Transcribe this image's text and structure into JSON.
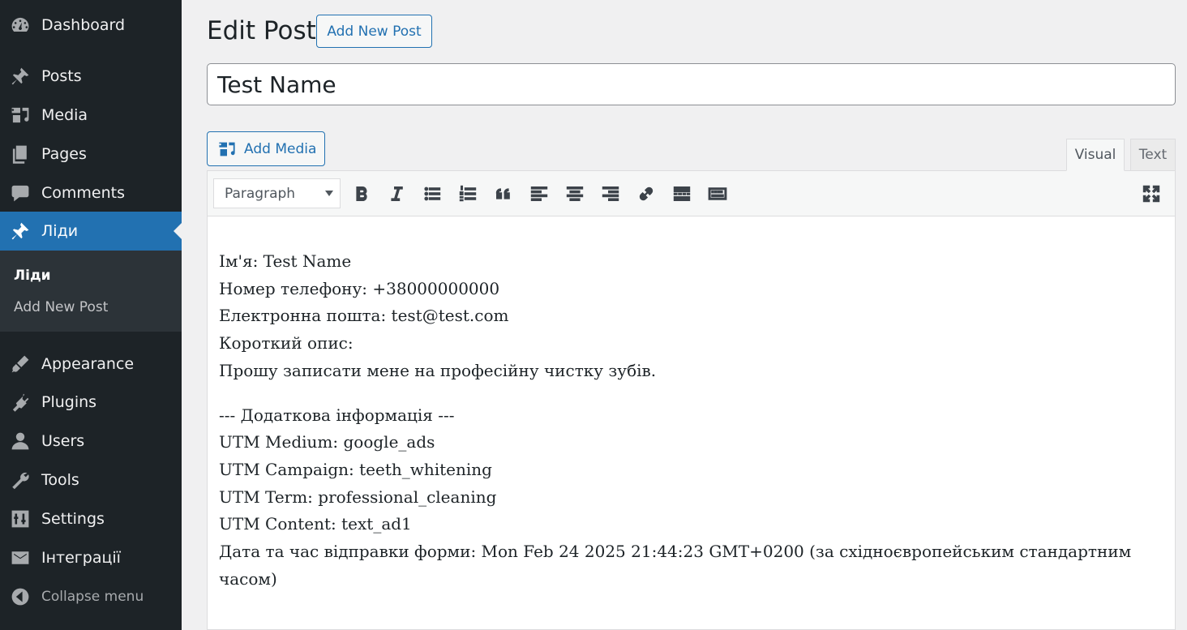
{
  "sidebar": {
    "items": [
      {
        "label": "Dashboard",
        "icon": "dashboard-icon"
      },
      {
        "label": "Posts",
        "icon": "pin-icon"
      },
      {
        "label": "Media",
        "icon": "media-icon"
      },
      {
        "label": "Pages",
        "icon": "pages-icon"
      },
      {
        "label": "Comments",
        "icon": "comment-icon"
      },
      {
        "label": "Ліди",
        "icon": "pin-icon",
        "current": true
      },
      {
        "label": "Appearance",
        "icon": "brush-icon"
      },
      {
        "label": "Plugins",
        "icon": "plugin-icon"
      },
      {
        "label": "Users",
        "icon": "user-icon"
      },
      {
        "label": "Tools",
        "icon": "wrench-icon"
      },
      {
        "label": "Settings",
        "icon": "settings-icon"
      },
      {
        "label": "Інтеграції",
        "icon": "email-icon"
      }
    ],
    "submenu": [
      {
        "label": "Ліди",
        "current": true
      },
      {
        "label": "Add New Post"
      }
    ],
    "collapse_label": "Collapse menu"
  },
  "header": {
    "title": "Edit Post",
    "add_new_label": "Add New Post"
  },
  "post": {
    "title": "Test Name"
  },
  "editor": {
    "add_media_label": "Add Media",
    "tabs": {
      "visual": "Visual",
      "text": "Text"
    },
    "active_tab": "Visual",
    "format_select": "Paragraph",
    "toolbar_icons": [
      "bold-icon",
      "italic-icon",
      "bulleted-list-icon",
      "numbered-list-icon",
      "blockquote-icon",
      "align-left-icon",
      "align-center-icon",
      "align-right-icon",
      "link-icon",
      "read-more-icon",
      "toolbar-toggle-icon",
      "fullscreen-icon"
    ],
    "content": {
      "para1": [
        "Ім'я: Test Name",
        "Номер телефону: +38000000000",
        "Електронна пошта: test@test.com",
        "Короткий опис:",
        "Прошу записати мене на професійну чистку зубів."
      ],
      "para2": [
        "--- Додаткова інформація ---",
        "UTM Medium: google_ads",
        "UTM Campaign: teeth_whitening",
        "UTM Term: professional_cleaning",
        "UTM Content: text_ad1",
        "Дата та час відправки форми: Mon Feb 24 2025 21:44:23 GMT+0200 (за східноєвропейським стандартним",
        "часом)"
      ]
    }
  },
  "colors": {
    "sidebar_bg": "#1d2327",
    "accent": "#2271b1",
    "page_bg": "#f0f0f1"
  }
}
